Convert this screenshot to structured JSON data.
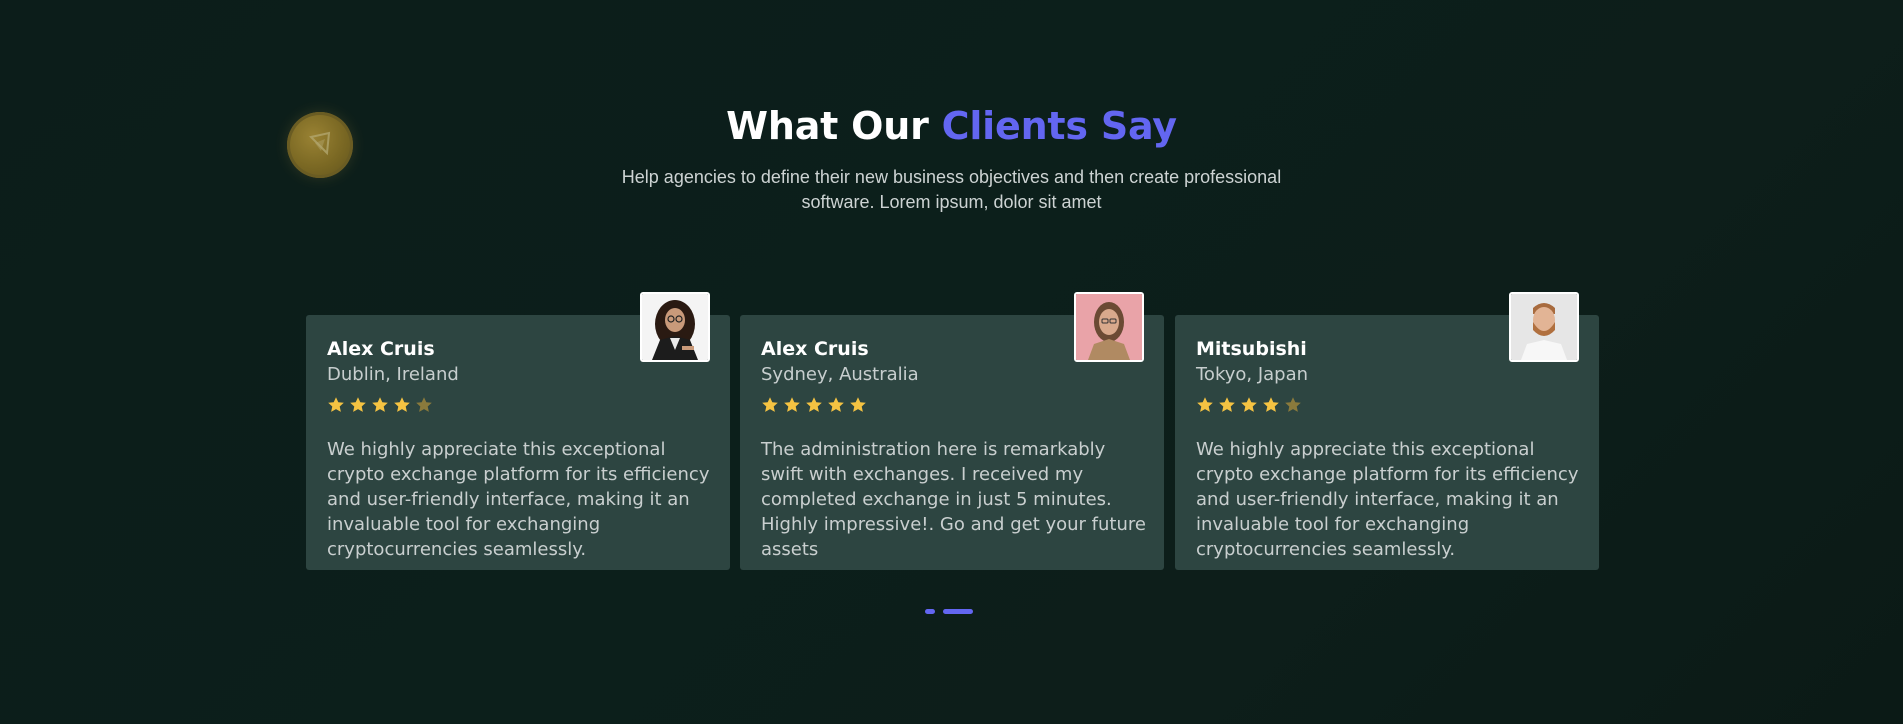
{
  "header": {
    "title_part1": "What Our ",
    "title_accent": "Clients Say",
    "subtitle": "Help agencies to define their new business objectives and then create professional software. Lorem ipsum, dolor sit amet"
  },
  "colors": {
    "accent": "#6366f1",
    "star_full": "#f5c342",
    "star_dim": "#8a7a3c",
    "card_bg": "#2d4541",
    "page_bg": "#0c1d1a"
  },
  "testimonials": [
    {
      "name": "Alex Cruis",
      "location": "Dublin, Ireland",
      "rating": 4,
      "rating_max": 5,
      "quote": "We highly appreciate this exceptional crypto exchange platform for its efficiency and user-friendly interface, making it an invaluable tool for exchanging cryptocurrencies seamlessly.",
      "avatar": "woman-with-glasses-avatar"
    },
    {
      "name": "Alex Cruis",
      "location": "Sydney, Australia",
      "rating": 5,
      "rating_max": 5,
      "quote": "The administration here is remarkably swift with exchanges. I received my completed exchange in just 5 minutes. Highly impressive!. Go and get your future assets",
      "avatar": "woman-on-pink-avatar"
    },
    {
      "name": "Mitsubishi",
      "location": "Tokyo, Japan",
      "rating": 4,
      "rating_max": 5,
      "quote": "We highly appreciate this exceptional crypto exchange platform for its efficiency and user-friendly interface, making it an invaluable tool for exchanging cryptocurrencies seamlessly.",
      "avatar": "bearded-man-avatar"
    }
  ],
  "pagination": {
    "pages": 2,
    "active_page": 2
  }
}
